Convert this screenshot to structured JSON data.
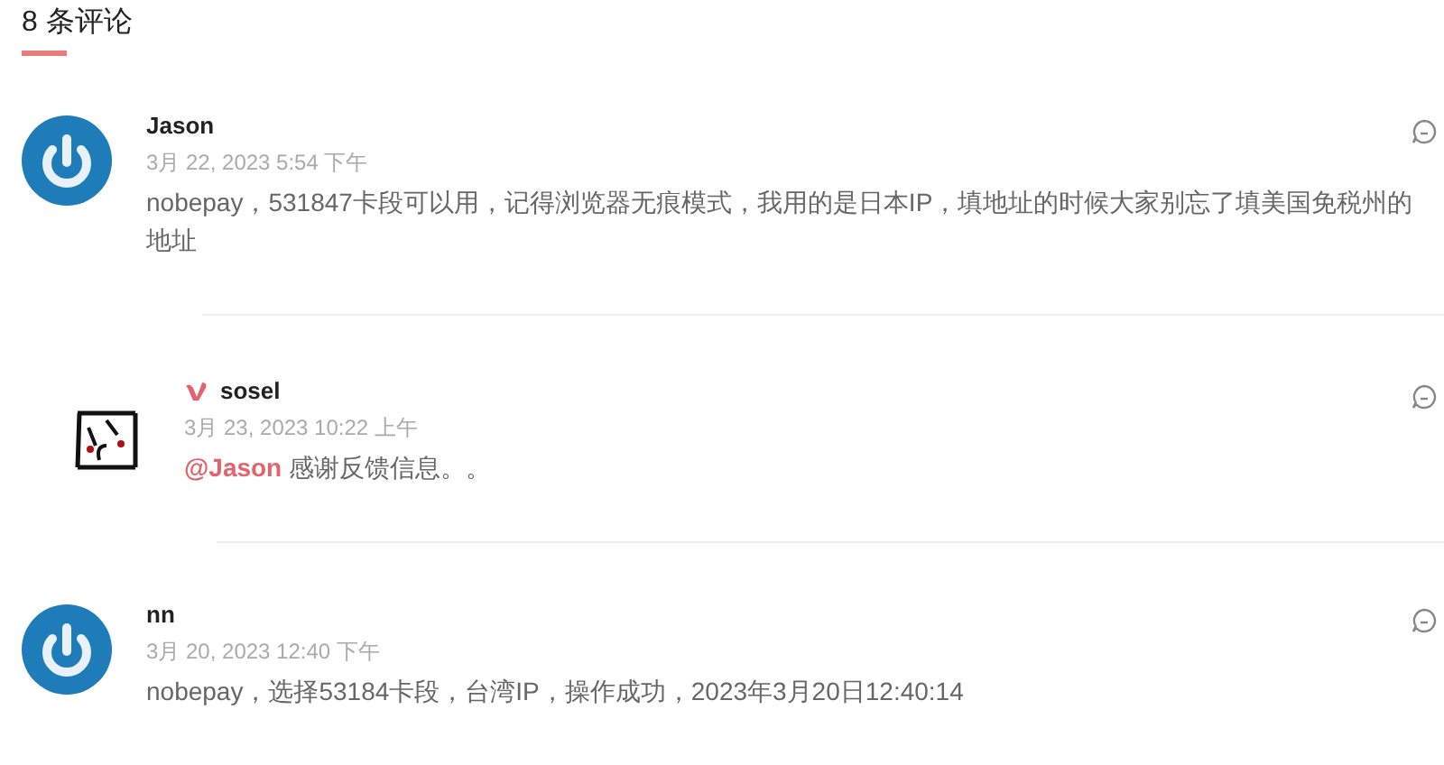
{
  "heading": "8 条评论",
  "comments": [
    {
      "kind": "default",
      "badge": false,
      "name": "Jason",
      "date": "3月 22, 2023 5:54 下午",
      "text": "nobepay，531847卡段可以用，记得浏览器无痕模式，我用的是日本IP，填地址的时候大家别忘了填美国免税州的地址",
      "replies": [
        {
          "kind": "custom",
          "badge": true,
          "name": "sosel",
          "date": "3月 23, 2023 10:22 上午",
          "mention": "@Jason",
          "text": "感谢反馈信息。。"
        }
      ]
    },
    {
      "kind": "default",
      "badge": false,
      "name": "nn",
      "date": "3月 20, 2023 12:40 下午",
      "text": "nobepay，选择53184卡段，台湾IP，操作成功，2023年3月20日12:40:14"
    }
  ]
}
